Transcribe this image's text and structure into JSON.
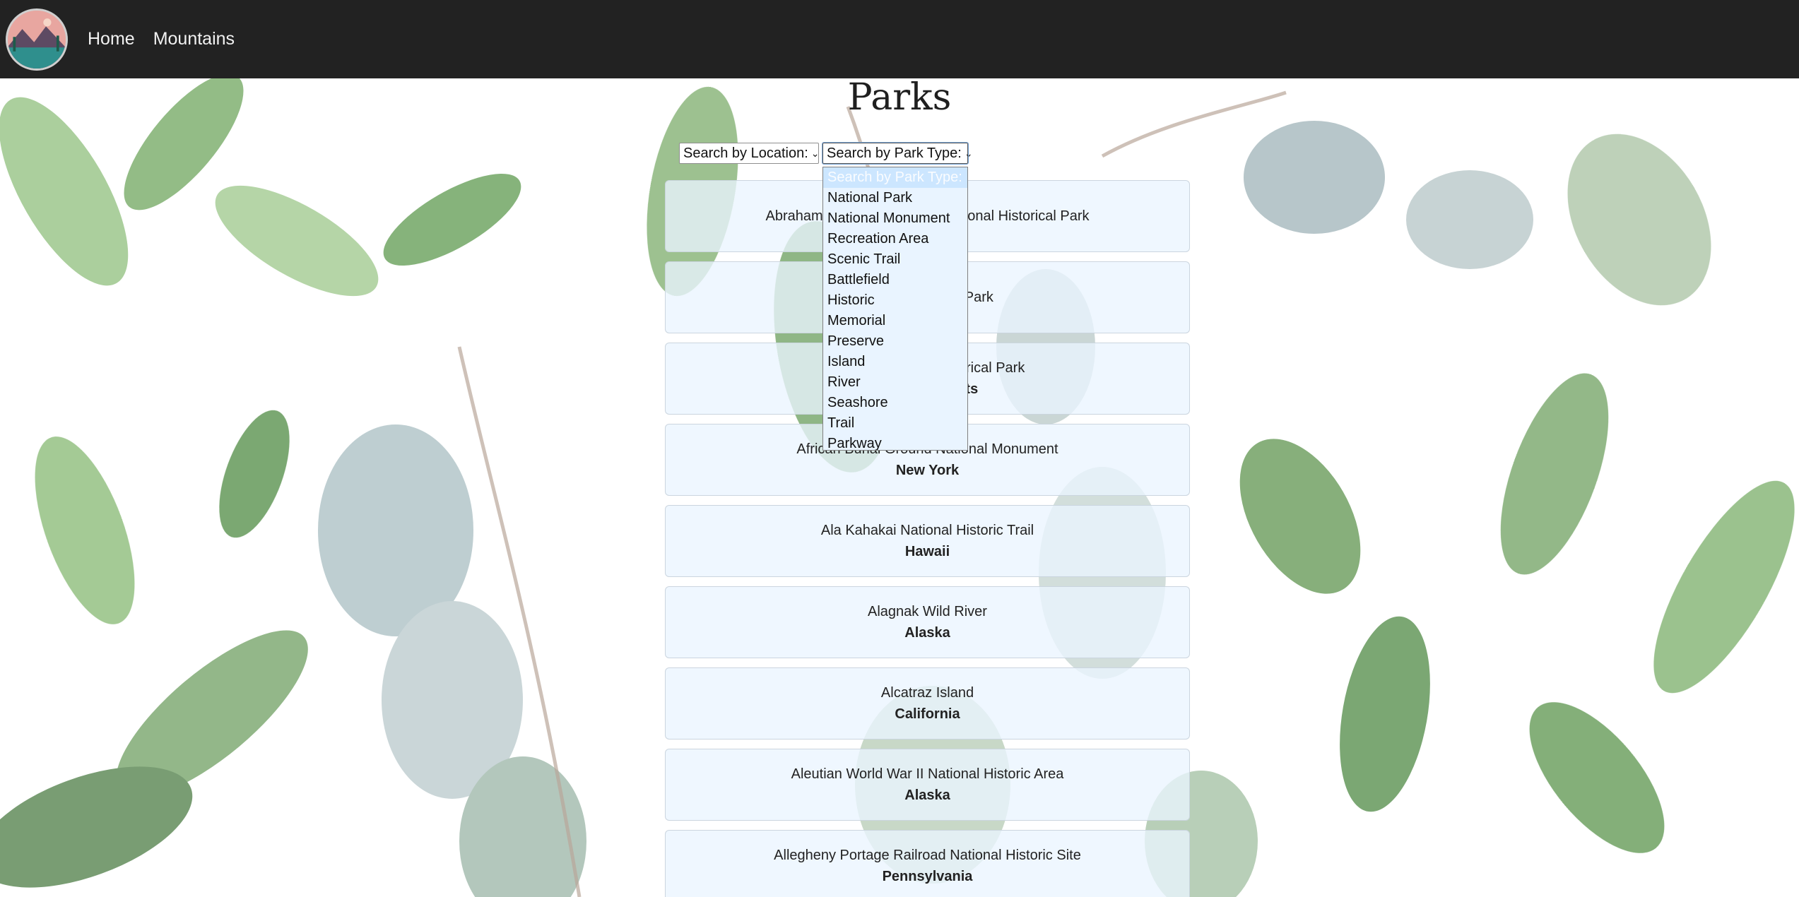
{
  "nav": {
    "links": [
      {
        "label": "Home"
      },
      {
        "label": "Mountains"
      }
    ]
  },
  "page": {
    "title": "Parks"
  },
  "filters": {
    "location_select": {
      "value": "Search by Location:"
    },
    "park_type_select": {
      "value": "Search by Park Type:",
      "open": true,
      "options": [
        "Search by Park Type:",
        "National Park",
        "National Monument",
        "Recreation Area",
        "Scenic Trail",
        "Battlefield",
        "Historic",
        "Memorial",
        "Preserve",
        "Island",
        "River",
        "Seashore",
        "Trail",
        "Parkway"
      ]
    }
  },
  "parks": [
    {
      "name": "Abraham Lincoln Birthplace National Historical Park",
      "state": ""
    },
    {
      "name": "Acadia National Park",
      "state": ""
    },
    {
      "name": "Adams National Historical Park",
      "state": "Massachusetts"
    },
    {
      "name": "African Burial Ground National Monument",
      "state": "New York"
    },
    {
      "name": "Ala Kahakai National Historic Trail",
      "state": "Hawaii"
    },
    {
      "name": "Alagnak Wild River",
      "state": "Alaska"
    },
    {
      "name": "Alcatraz Island",
      "state": "California"
    },
    {
      "name": "Aleutian World War II National Historic Area",
      "state": "Alaska"
    },
    {
      "name": "Allegheny Portage Railroad National Historic Site",
      "state": "Pennsylvania"
    }
  ],
  "colors": {
    "navbar": "#222222",
    "card_bg": "#ebf5ff",
    "dropdown_bg": "#e9f4ff",
    "dropdown_selected": "#cce6ff",
    "leaf_green": "#7fae6e",
    "leaf_blue": "#9fb3b8"
  }
}
